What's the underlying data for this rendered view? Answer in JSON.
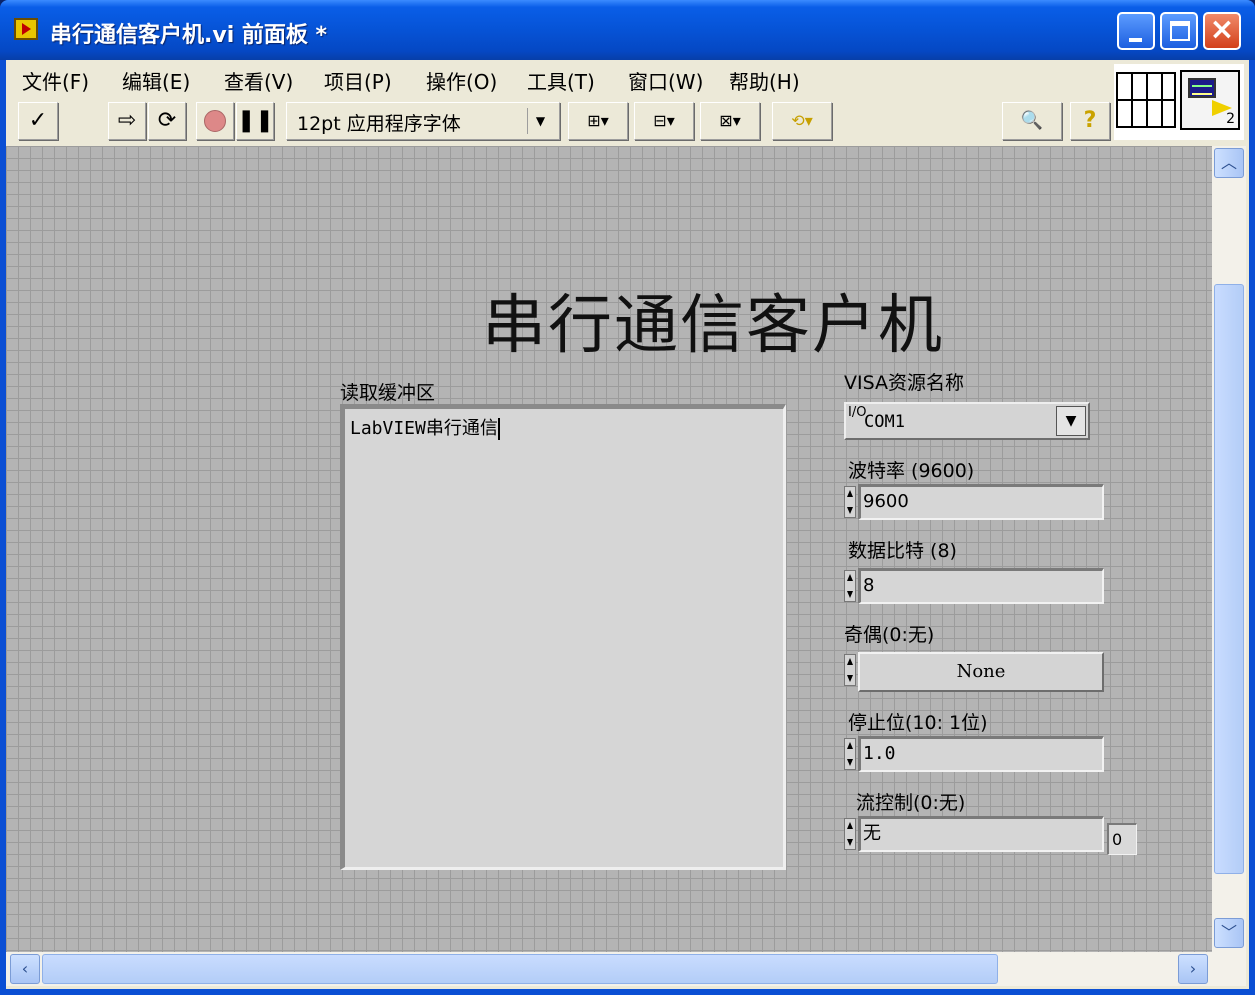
{
  "window": {
    "title": "串行通信客户机.vi 前面板 *",
    "controls": {
      "minimize": "_",
      "maximize": "□",
      "close": "×"
    }
  },
  "menu": [
    "文件(F)",
    "编辑(E)",
    "查看(V)",
    "项目(P)",
    "操作(O)",
    "工具(T)",
    "窗口(W)",
    "帮助(H)"
  ],
  "toolbar": {
    "font": "12pt 应用程序字体",
    "icons": [
      "checkmark-icon",
      "run-arrow-icon",
      "run-continuously-icon",
      "abort-icon",
      "pause-icon",
      "align-icon",
      "distribute-icon",
      "resize-icon",
      "reorder-icon",
      "search-icon",
      "help-icon"
    ]
  },
  "connector": {
    "number": "2"
  },
  "panel": {
    "title": "串行通信客户机",
    "read_buffer": {
      "label": "读取缓冲区",
      "value": "LabVIEW串行通信"
    },
    "visa": {
      "label": "VISA资源名称",
      "io_glyph": "I/O",
      "value": "COM1"
    },
    "baud": {
      "label": "波特率 (9600)",
      "value": "9600"
    },
    "databits": {
      "label": "数据比特 (8)",
      "value": "8"
    },
    "parity": {
      "label": "奇偶(0:无)",
      "value": "None"
    },
    "stopbits": {
      "label": "停止位(10: 1位)",
      "value": "1.0"
    },
    "flow": {
      "label": "流控制(0:无)",
      "value": "无",
      "numeric": "0"
    }
  },
  "colors": {
    "titlebar": "#0653d6",
    "panel_grid_bg": "#b4b4b4",
    "menu_bg": "#ece9d8",
    "close_button": "#d3401a"
  }
}
